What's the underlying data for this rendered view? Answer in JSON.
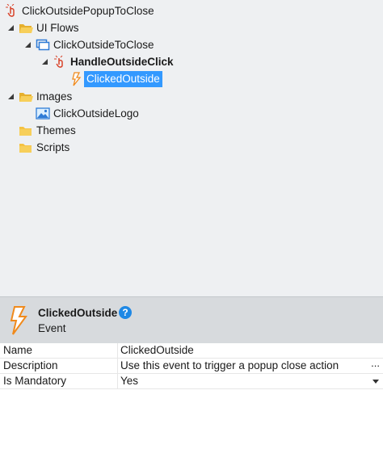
{
  "tree": {
    "root": "ClickOutsidePopupToClose",
    "ui_flows": "UI Flows",
    "screen": "ClickOutsideToClose",
    "action": "HandleOutsideClick",
    "event": "ClickedOutside",
    "images": "Images",
    "image_item": "ClickOutsideLogo",
    "themes": "Themes",
    "scripts": "Scripts"
  },
  "header": {
    "title": "ClickedOutside",
    "subtitle": "Event",
    "help": "?"
  },
  "properties": [
    {
      "key": "Name",
      "value": "ClickedOutside"
    },
    {
      "key": "Description",
      "value": "Use this event to trigger a popup close action",
      "extra": "..."
    },
    {
      "key": "Is Mandatory",
      "value": "Yes"
    }
  ],
  "colors": {
    "selection": "#3399ff",
    "folder": "#f5c242",
    "action_red": "#d9442b",
    "event_orange": "#f08a1c",
    "screen_blue": "#2e7bd6"
  }
}
